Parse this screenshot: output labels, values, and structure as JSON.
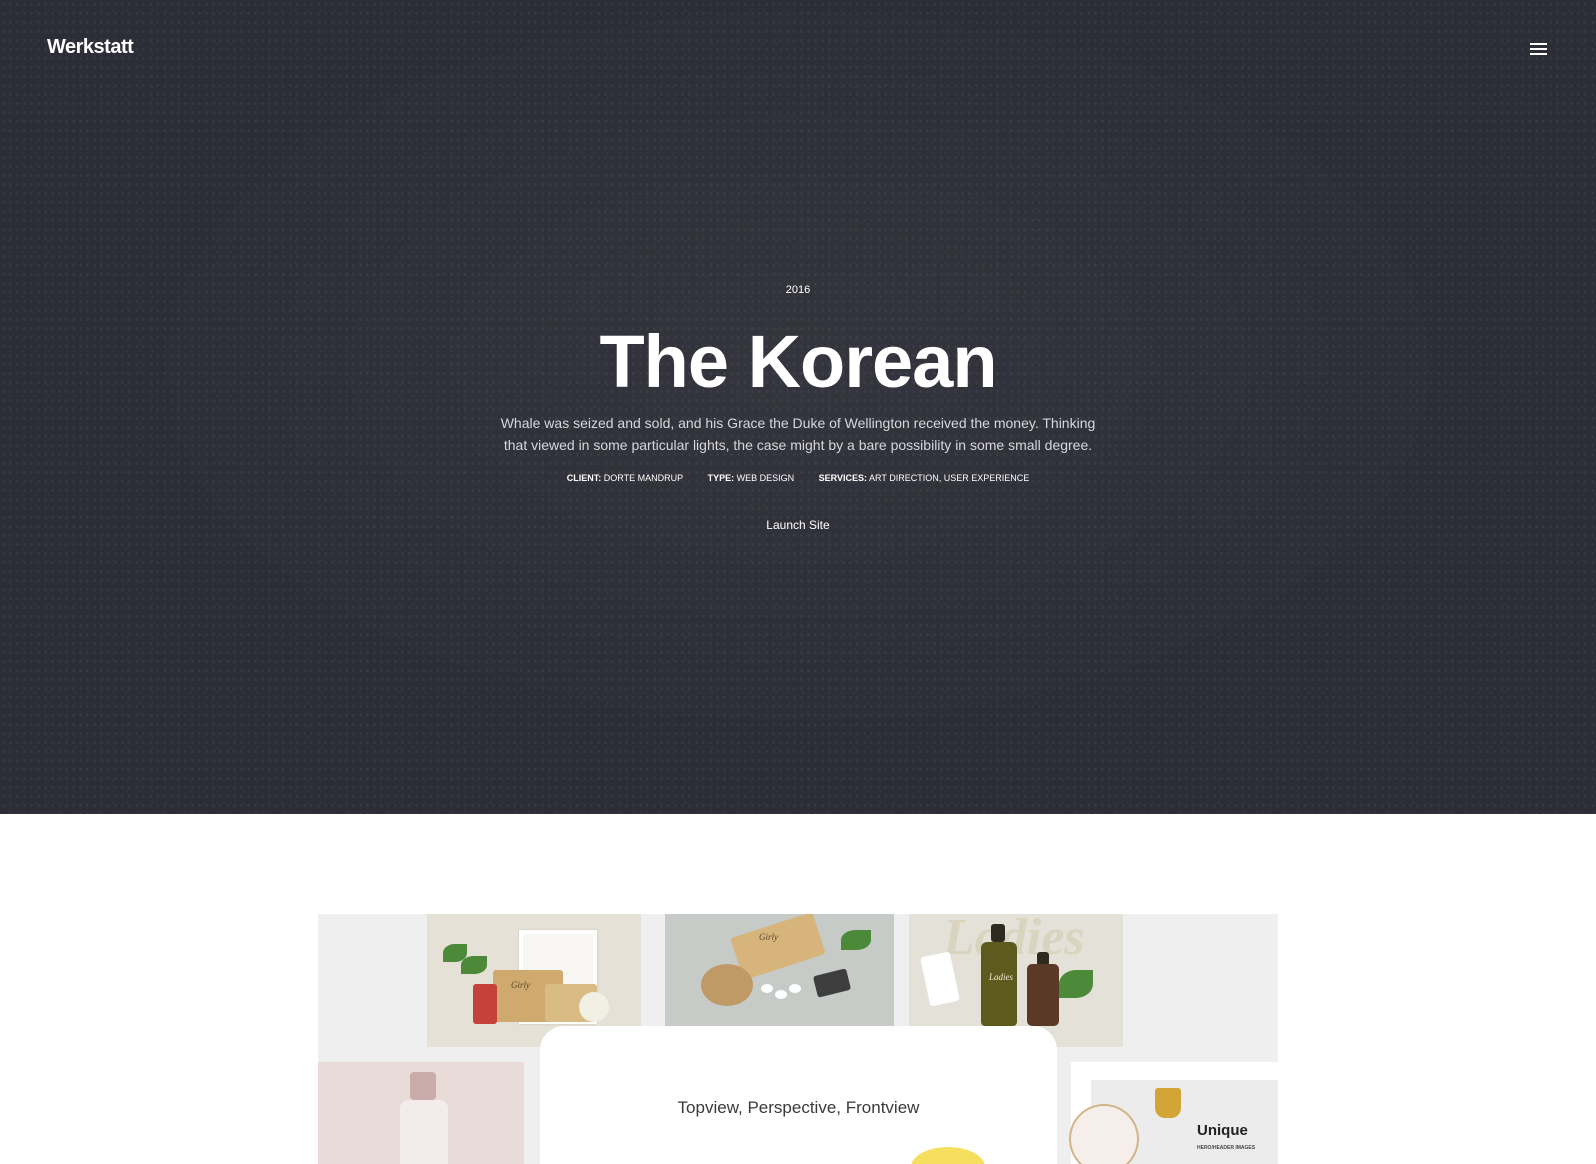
{
  "header": {
    "logo": "Werkstatt",
    "menu_icon": "hamburger-menu-icon"
  },
  "hero": {
    "year": "2016",
    "title": "The Korean",
    "description": "Whale was seized and sold, and his Grace the Duke of Wellington received the money. Thinking that viewed in some particular lights, the case might by a bare possibility in some small degree.",
    "meta": [
      {
        "label": "CLIENT:",
        "value": "DORTE MANDRUP"
      },
      {
        "label": "TYPE:",
        "value": "WEB DESIGN"
      },
      {
        "label": "SERVICES:",
        "value": "ART DIRECTION, USER EXPERIENCE"
      }
    ],
    "cta": "Launch Site"
  },
  "showcase": {
    "card_title": "Topview, Perspective, Frontview",
    "ladies_label": "Ladies",
    "girly_label": "Girly",
    "unique_title": "Unique",
    "unique_subtitle": "HERO/HEADER IMAGES"
  },
  "colors": {
    "hero_bg": "#2d2d37",
    "text_light": "#ffffff",
    "accent_yellow": "#f6df5e"
  }
}
